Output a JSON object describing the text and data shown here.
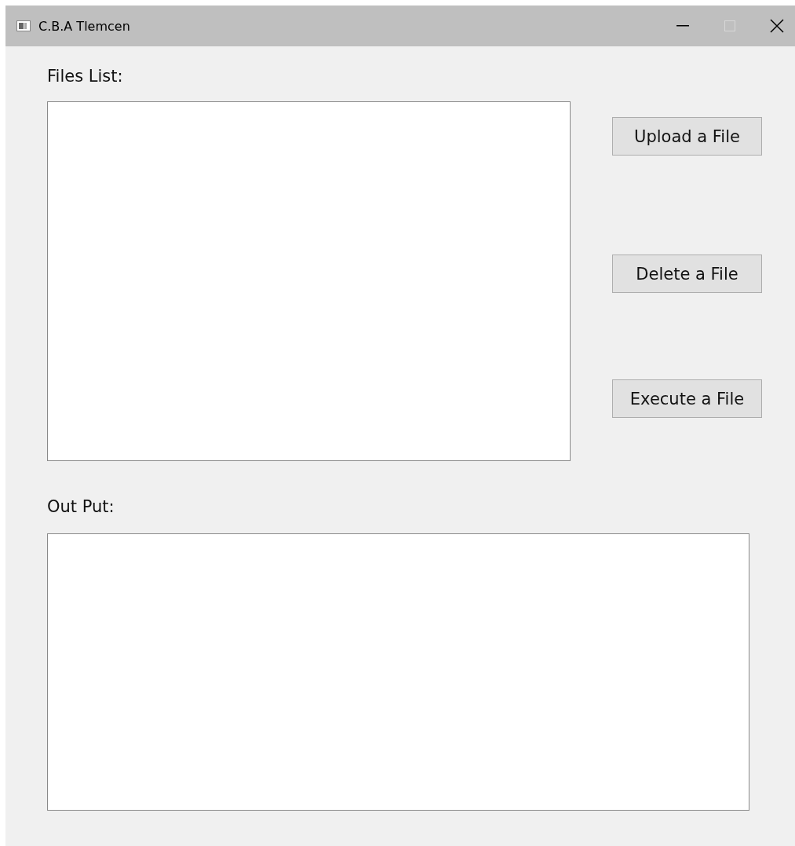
{
  "window": {
    "title": "C.B.A Tlemcen"
  },
  "files_list": {
    "label": "Files List:"
  },
  "buttons": [
    "Upload a File",
    "Delete a File",
    "Execute a File"
  ],
  "output": {
    "label": "Out Put:"
  }
}
